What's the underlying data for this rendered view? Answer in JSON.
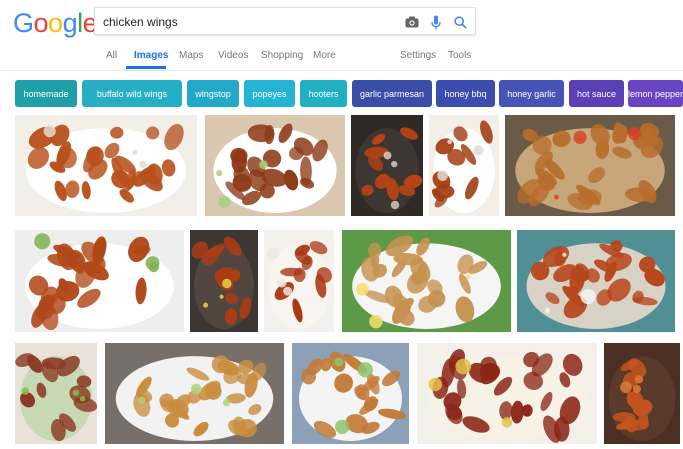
{
  "logo": {
    "letters": [
      "G",
      "o",
      "o",
      "g",
      "l",
      "e"
    ],
    "colors": [
      "#4285F4",
      "#EA4335",
      "#FBBC05",
      "#4285F4",
      "#34A853",
      "#EA4335"
    ]
  },
  "search": {
    "value": "chicken wings",
    "placeholder": ""
  },
  "nav": {
    "all": "All",
    "images": "Images",
    "maps": "Maps",
    "videos": "Videos",
    "shopping": "Shopping",
    "more": "More",
    "settings": "Settings",
    "tools": "Tools"
  },
  "chips": [
    {
      "label": "homemade",
      "color": "#1fa0a8"
    },
    {
      "label": "buffalo wild wings",
      "color": "#26aec5"
    },
    {
      "label": "wingstop",
      "color": "#22a9c9"
    },
    {
      "label": "popeyes",
      "color": "#23b4d3"
    },
    {
      "label": "hooters",
      "color": "#1fb1c1"
    },
    {
      "label": "garlic parmesan",
      "color": "#3b4ea7"
    },
    {
      "label": "honey bbq",
      "color": "#3c4db0"
    },
    {
      "label": "honey garlic",
      "color": "#4655b5"
    },
    {
      "label": "hot sauce",
      "color": "#5b3fb5"
    },
    {
      "label": "lemon pepper",
      "color": "#6a45c1"
    }
  ],
  "colors": {
    "accent": "#1a73e8",
    "mic": "#4285F4",
    "search_icon": "#4285F4",
    "camera": "#666666"
  },
  "images": [
    {
      "alt": "chicken wings image 1",
      "bg": "#f2efe9",
      "plate": "#ffffff",
      "food": "#b8501c",
      "accent": "#e9d9c9"
    },
    {
      "alt": "chicken wings image 2",
      "bg": "#d9c7b0",
      "plate": "#ffffff",
      "food": "#8e3a18",
      "accent": "#a6cf7a"
    },
    {
      "alt": "chicken wings image 3",
      "bg": "#2f2a26",
      "plate": "#3e3632",
      "food": "#b54314",
      "accent": "#d5c9be"
    },
    {
      "alt": "chicken wings image 4",
      "bg": "#f3efe8",
      "plate": "#ffffff",
      "food": "#a33e12",
      "accent": "#e4dbcf"
    },
    {
      "alt": "chicken wings image 5",
      "bg": "#6a5a48",
      "plate": "#c7a77a",
      "food": "#b86d2c",
      "accent": "#d8432a"
    },
    {
      "alt": "chicken wings image 6",
      "bg": "#eeeeee",
      "plate": "#ffffff",
      "food": "#b04718",
      "accent": "#7fb04d"
    },
    {
      "alt": "chicken wings image 7",
      "bg": "#3d3733",
      "plate": "#51463f",
      "food": "#ad3c12",
      "accent": "#e9d04a"
    },
    {
      "alt": "chicken wings image 8",
      "bg": "#f4f1ec",
      "plate": "#f8f5f0",
      "food": "#a93914",
      "accent": "#efe7dd"
    },
    {
      "alt": "chicken wings image 9",
      "bg": "#5c9a47",
      "plate": "#f5f5f5",
      "food": "#c6924f",
      "accent": "#f3df6a"
    },
    {
      "alt": "chicken wings image 10",
      "bg": "#4f8f95",
      "plate": "#d8d2c6",
      "food": "#b6461b",
      "accent": "#f4f4f4"
    },
    {
      "alt": "chicken wings image 11",
      "bg": "#e9e2d8",
      "plate": "#c6d8b4",
      "food": "#8c3a24",
      "accent": "#80c04a"
    },
    {
      "alt": "chicken wings image 12",
      "bg": "#77706a",
      "plate": "#f2f2f2",
      "food": "#c98d3f",
      "accent": "#a8d477"
    },
    {
      "alt": "chicken wings image 13",
      "bg": "#8ca0b7",
      "plate": "#f4f4f4",
      "food": "#c27a3a",
      "accent": "#8cc46a"
    },
    {
      "alt": "chicken wings image 14",
      "bg": "#f3f0ea",
      "plate": "#f7f2e6",
      "food": "#8a2717",
      "accent": "#e2c24a"
    },
    {
      "alt": "chicken wings image 15",
      "bg": "#4a2f22",
      "plate": "#5a3a2a",
      "food": "#c5541e",
      "accent": "#e07a35"
    }
  ]
}
